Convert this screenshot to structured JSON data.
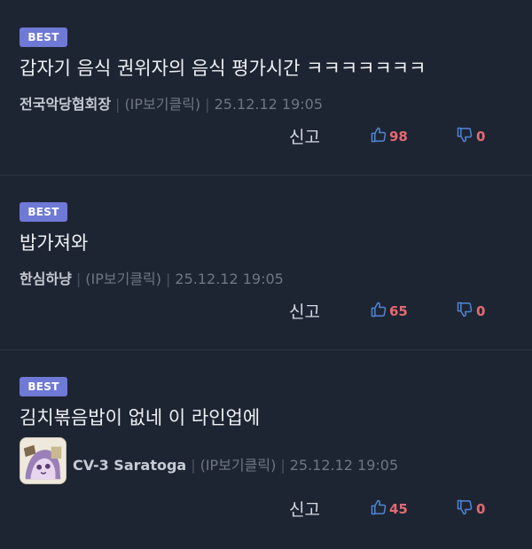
{
  "comments": [
    {
      "badge": "BEST",
      "text": "갑자기 음식 권위자의 음식 평가시간 ㅋㅋㅋㅋㅋㅋㅋ",
      "author": "전국악당협회장",
      "ip_label": "(IP보기클릭)",
      "date": "25.12.12 19:05",
      "report_label": "신고",
      "likes": "98",
      "dislikes": "0"
    },
    {
      "badge": "BEST",
      "text": "밥가져와",
      "author": "한심하냥",
      "ip_label": "(IP보기클릭)",
      "date": "25.12.12 19:05",
      "report_label": "신고",
      "likes": "65",
      "dislikes": "0"
    },
    {
      "badge": "BEST",
      "text": "김치볶음밥이 없네 이 라인업에",
      "author": "CV-3 Saratoga",
      "ip_label": "(IP보기클릭)",
      "date": "25.12.12 19:05",
      "report_label": "신고",
      "likes": "45",
      "dislikes": "0"
    }
  ],
  "colors": {
    "background": "#1e2532",
    "badge": "#6f79d6",
    "like_icon": "#4f86d6",
    "count": "#e46a72"
  },
  "icons": [
    "thumbs-up-icon",
    "thumbs-down-icon"
  ]
}
